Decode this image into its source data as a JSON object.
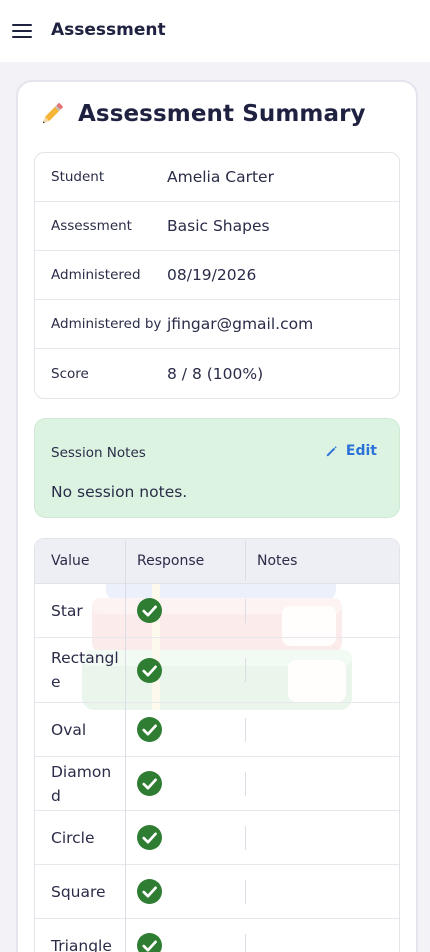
{
  "topbar": {
    "title": "Assessment",
    "menu_icon": "hamburger-menu-icon"
  },
  "summary": {
    "title": "Assessment Summary",
    "icon": "pencil-icon"
  },
  "info": [
    {
      "label": "Student",
      "value": "Amelia Carter"
    },
    {
      "label": "Assessment",
      "value": "Basic Shapes"
    },
    {
      "label": "Administered",
      "value": "08/19/2026"
    },
    {
      "label": "Administered by",
      "value": "jfingar@gmail.com"
    },
    {
      "label": "Score",
      "value": "8 / 8 (100%)"
    }
  ],
  "session_notes": {
    "label": "Session Notes",
    "edit_label": "Edit",
    "text": "No session notes.",
    "background_color": "#ddf3e2"
  },
  "responses": {
    "headers": {
      "value": "Value",
      "response": "Response",
      "notes": "Notes"
    },
    "rows": [
      {
        "value": "Star",
        "response": "correct",
        "notes": ""
      },
      {
        "value": "Rectangle",
        "response": "correct",
        "notes": ""
      },
      {
        "value": "Oval",
        "response": "correct",
        "notes": ""
      },
      {
        "value": "Diamond",
        "response": "correct",
        "notes": ""
      },
      {
        "value": "Circle",
        "response": "correct",
        "notes": ""
      },
      {
        "value": "Square",
        "response": "correct",
        "notes": ""
      },
      {
        "value": "Triangle",
        "response": "correct",
        "notes": ""
      }
    ]
  },
  "colors": {
    "accent": "#2c72d8",
    "correct": "#2e7d32",
    "text": "#1f2140"
  }
}
